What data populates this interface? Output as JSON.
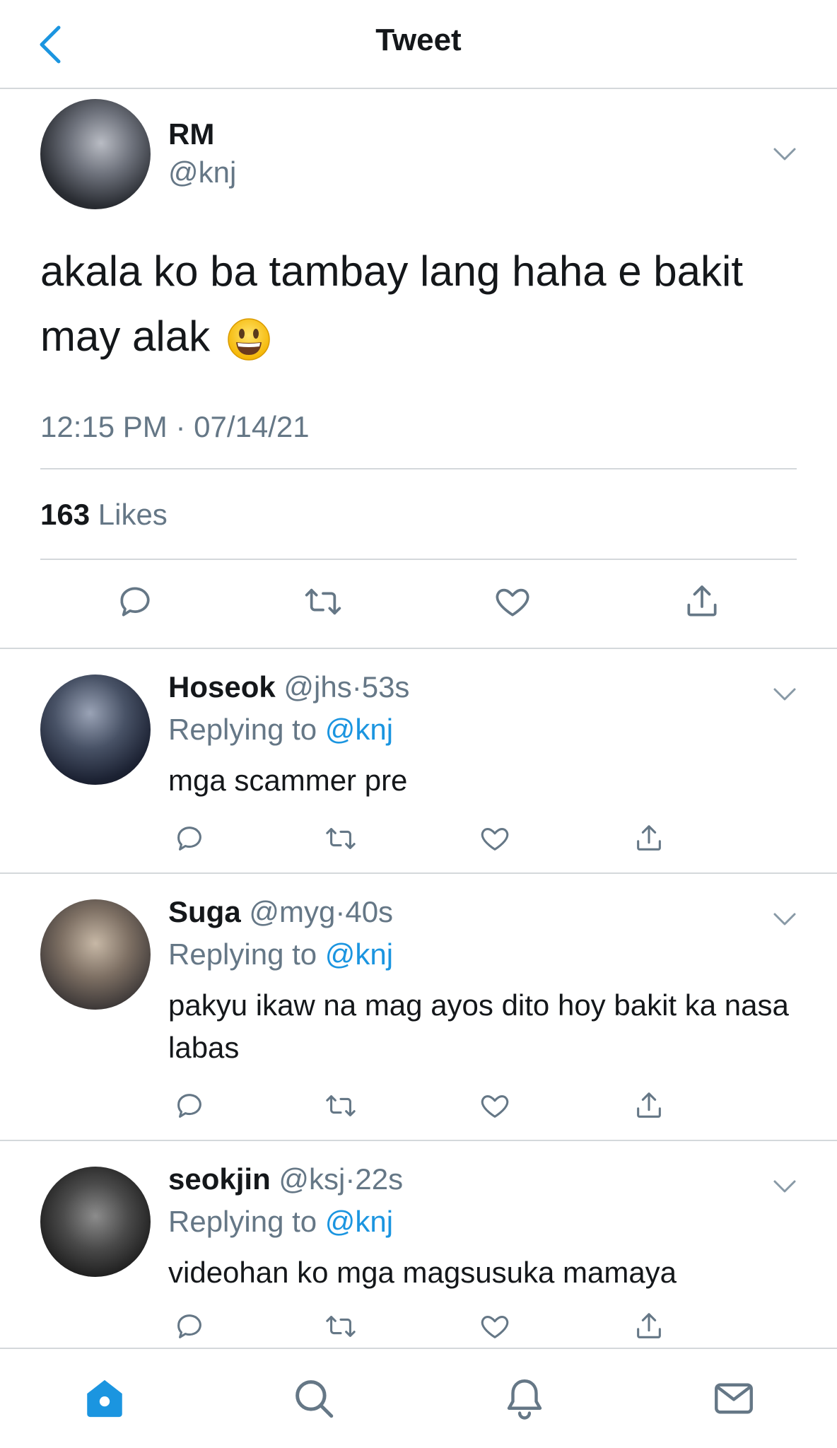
{
  "header": {
    "title": "Tweet",
    "back_icon": "chevron-left-icon",
    "accent": "#1b95e0"
  },
  "main_tweet": {
    "name": "RM",
    "handle": "@knj",
    "text": "akala ko ba tambay lang haha e bakit may alak",
    "emoji": "smiley-emoji",
    "timestamp": "12:15 PM · 07/14/21",
    "likes_count": "163",
    "likes_label": "Likes"
  },
  "replies": [
    {
      "name": "Hoseok",
      "handle": "@jhs",
      "sep": "·",
      "time": "53s",
      "replying_prefix": "Replying to",
      "replying_to": "@knj",
      "text": "mga scammer pre"
    },
    {
      "name": "Suga",
      "handle": "@myg",
      "sep": "·",
      "time": "40s",
      "replying_prefix": "Replying to",
      "replying_to": "@knj",
      "text": "pakyu ikaw na mag ayos dito hoy bakit ka nasa labas"
    },
    {
      "name": "seokjin",
      "handle": "@ksj",
      "sep": "·",
      "time": "22s",
      "replying_prefix": "Replying to",
      "replying_to": "@knj",
      "text": "videohan ko mga magsusuka mamaya"
    }
  ],
  "action_icons": [
    "reply-icon",
    "retweet-icon",
    "like-icon",
    "share-icon"
  ],
  "tab_bar": {
    "items": [
      "home-icon",
      "search-icon",
      "notifications-icon",
      "messages-icon"
    ],
    "active": "home-icon"
  },
  "colors": {
    "text": "#14171a",
    "secondary": "#657786",
    "divider": "#d4d8db",
    "accent": "#1b95e0"
  }
}
